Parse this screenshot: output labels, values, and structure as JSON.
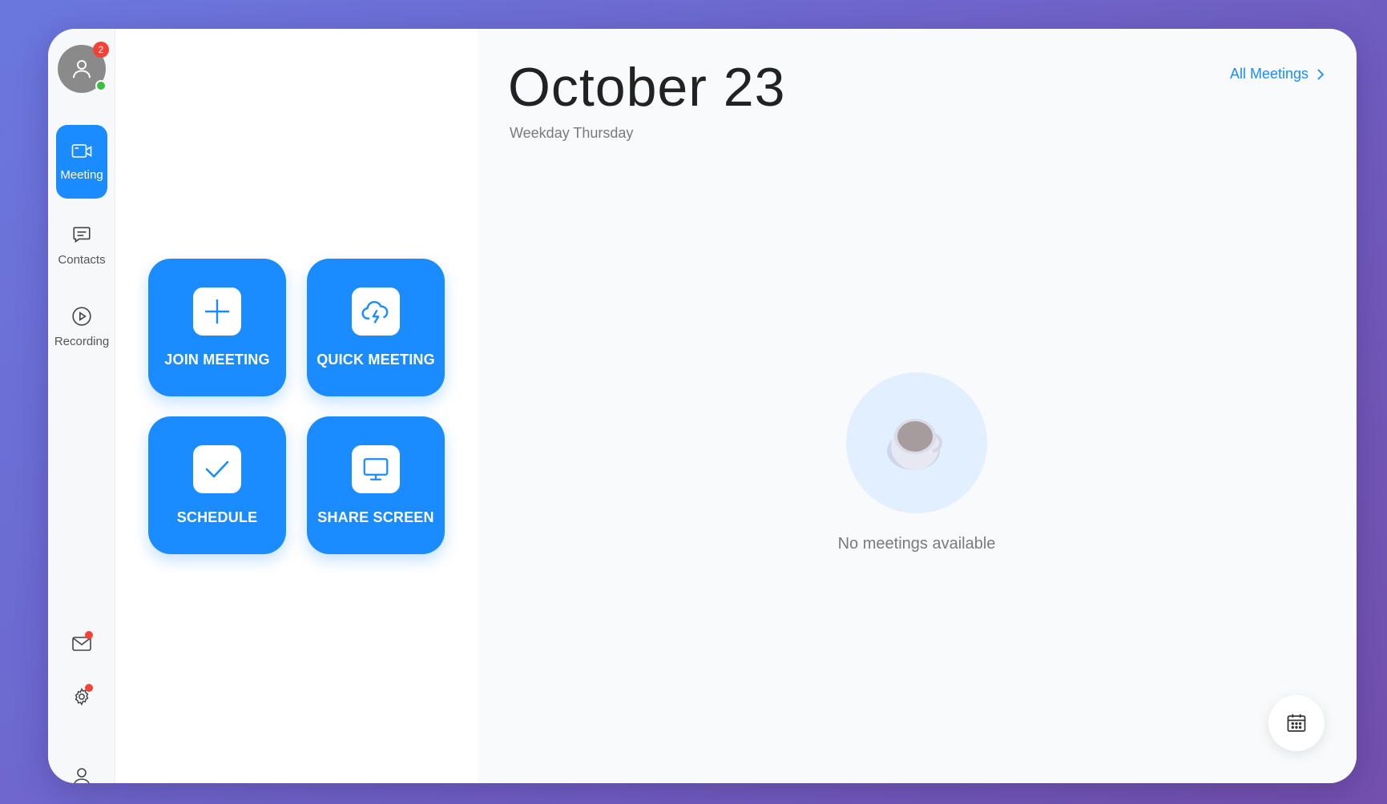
{
  "sidebar": {
    "avatar_badge": "2",
    "nav": [
      {
        "label": "Meeting",
        "icon": "video-camera-icon",
        "active": true
      },
      {
        "label": "Contacts",
        "icon": "chat-icon",
        "active": false
      },
      {
        "label": "Recording",
        "icon": "play-circle-icon",
        "active": false
      }
    ],
    "bottom_icons": [
      "mail-icon",
      "gear-icon",
      "user-icon"
    ]
  },
  "actions": [
    {
      "label": "JOIN MEETING",
      "icon": "plus-icon"
    },
    {
      "label": "QUICK MEETING",
      "icon": "cloud-lightning-icon"
    },
    {
      "label": "SCHEDULE",
      "icon": "check-icon"
    },
    {
      "label": "SHARE SCREEN",
      "icon": "monitor-icon"
    }
  ],
  "main": {
    "date_title": "October 23",
    "weekday": "Weekday Thursday",
    "all_meetings_link": "All Meetings",
    "empty_text": "No meetings available",
    "empty_icon": "coffee-cup-icon",
    "fab_icon": "calendar-icon"
  },
  "colors": {
    "accent": "#1a8cff",
    "badge": "#f44336",
    "online": "#35c13e",
    "empty_circle": "#e1efff"
  }
}
